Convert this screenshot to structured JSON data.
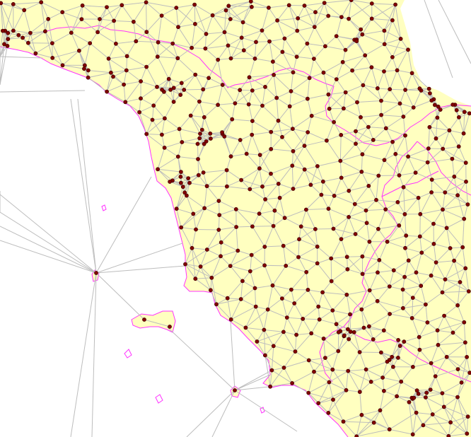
{
  "map": {
    "type": "delaunay-triangulation-overlay",
    "region": "Central Italy",
    "colors": {
      "land": "#ffffc0",
      "water": "#ffffff",
      "coastline": "#ff33ff",
      "region_borders": "#ff33ff",
      "triangulation_edges": "#bdbdbd",
      "points": "#800000"
    },
    "point_count_estimate": 520,
    "islands_shown": true
  }
}
